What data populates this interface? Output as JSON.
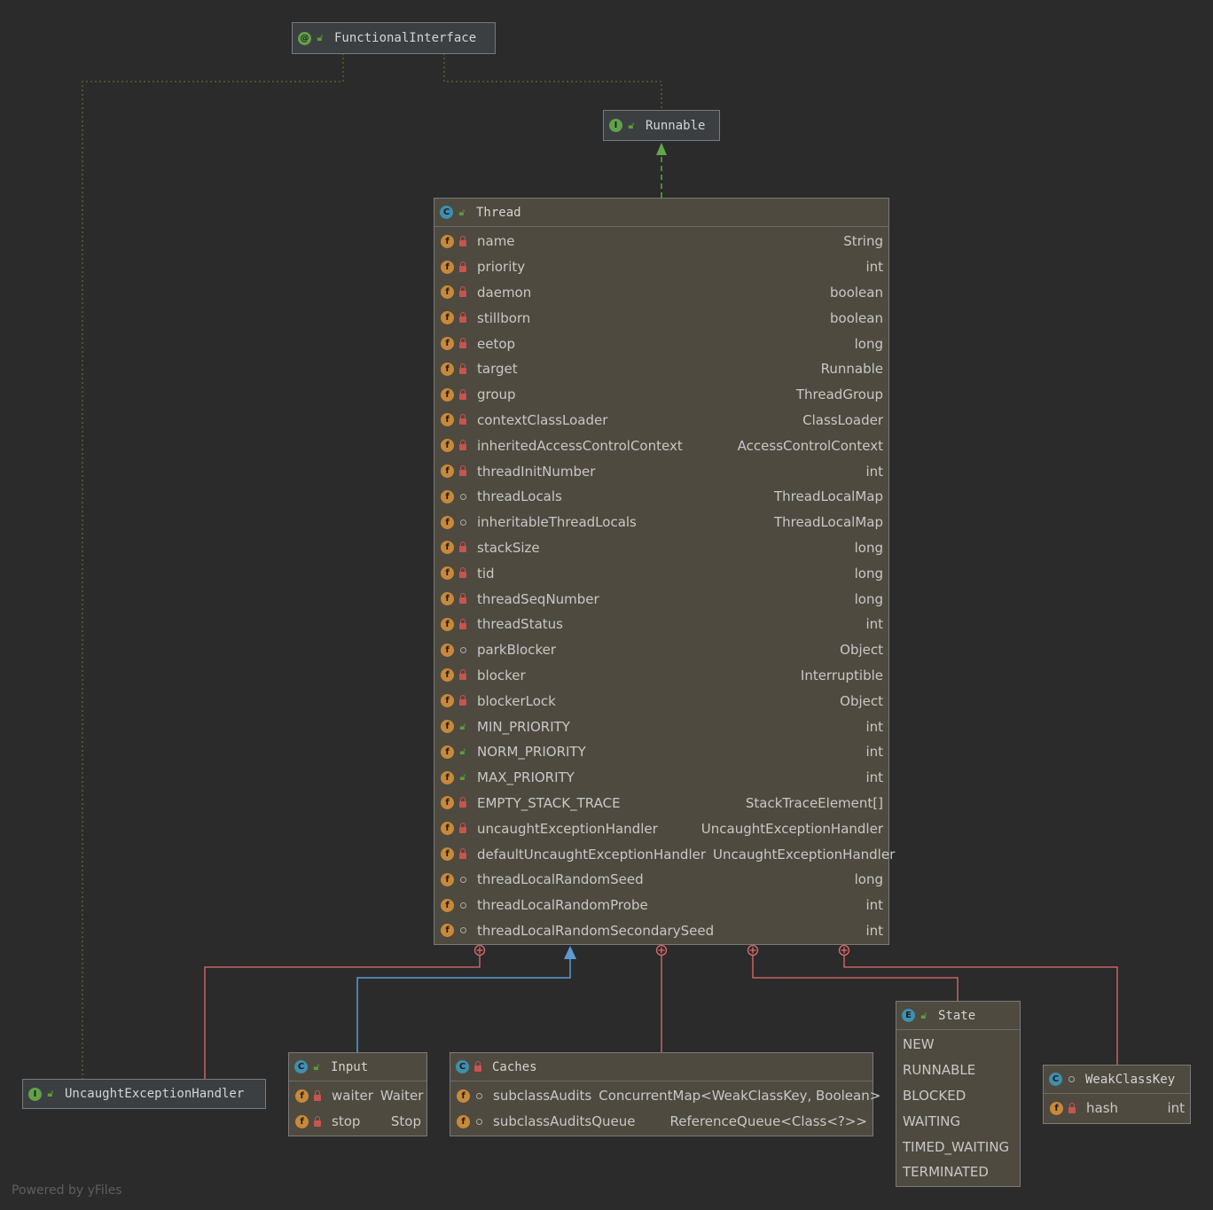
{
  "watermark": "Powered by yFiles",
  "colors": {
    "background": "#2b2b2b",
    "node_fill": "#4e4a3f",
    "inner_class_edge": "#e06c6c",
    "extends_edge": "#5b9bd5",
    "implements_edge": "#5fa84b",
    "annotation_edge": "#6a7a3a"
  },
  "nodes": {
    "functional_interface": {
      "name": "FunctionalInterface",
      "kind_icon": "annotation-icon",
      "badge": "@"
    },
    "runnable": {
      "name": "Runnable",
      "kind_icon": "interface-icon",
      "badge": "I"
    },
    "thread": {
      "name": "Thread",
      "kind_icon": "class-icon",
      "badge": "C",
      "fields": [
        {
          "name": "name",
          "type": "String",
          "vis": "private"
        },
        {
          "name": "priority",
          "type": "int",
          "vis": "private"
        },
        {
          "name": "daemon",
          "type": "boolean",
          "vis": "private"
        },
        {
          "name": "stillborn",
          "type": "boolean",
          "vis": "private"
        },
        {
          "name": "eetop",
          "type": "long",
          "vis": "private"
        },
        {
          "name": "target",
          "type": "Runnable",
          "vis": "private"
        },
        {
          "name": "group",
          "type": "ThreadGroup",
          "vis": "private"
        },
        {
          "name": "contextClassLoader",
          "type": "ClassLoader",
          "vis": "private"
        },
        {
          "name": "inheritedAccessControlContext",
          "type": "AccessControlContext",
          "vis": "private"
        },
        {
          "name": "threadInitNumber",
          "type": "int",
          "vis": "private"
        },
        {
          "name": "threadLocals",
          "type": "ThreadLocalMap",
          "vis": "package"
        },
        {
          "name": "inheritableThreadLocals",
          "type": "ThreadLocalMap",
          "vis": "package"
        },
        {
          "name": "stackSize",
          "type": "long",
          "vis": "private"
        },
        {
          "name": "tid",
          "type": "long",
          "vis": "private"
        },
        {
          "name": "threadSeqNumber",
          "type": "long",
          "vis": "private"
        },
        {
          "name": "threadStatus",
          "type": "int",
          "vis": "private"
        },
        {
          "name": "parkBlocker",
          "type": "Object",
          "vis": "package"
        },
        {
          "name": "blocker",
          "type": "Interruptible",
          "vis": "private"
        },
        {
          "name": "blockerLock",
          "type": "Object",
          "vis": "private"
        },
        {
          "name": "MIN_PRIORITY",
          "type": "int",
          "vis": "public"
        },
        {
          "name": "NORM_PRIORITY",
          "type": "int",
          "vis": "public"
        },
        {
          "name": "MAX_PRIORITY",
          "type": "int",
          "vis": "public"
        },
        {
          "name": "EMPTY_STACK_TRACE",
          "type": "StackTraceElement[]",
          "vis": "private"
        },
        {
          "name": "uncaughtExceptionHandler",
          "type": "UncaughtExceptionHandler",
          "vis": "private"
        },
        {
          "name": "defaultUncaughtExceptionHandler",
          "type": "UncaughtExceptionHandler",
          "vis": "private"
        },
        {
          "name": "threadLocalRandomSeed",
          "type": "long",
          "vis": "package"
        },
        {
          "name": "threadLocalRandomProbe",
          "type": "int",
          "vis": "package"
        },
        {
          "name": "threadLocalRandomSecondarySeed",
          "type": "int",
          "vis": "package"
        }
      ]
    },
    "uncaught_handler": {
      "name": "UncaughtExceptionHandler",
      "kind_icon": "interface-icon",
      "badge": "I"
    },
    "input": {
      "name": "Input",
      "kind_icon": "class-icon",
      "badge": "C",
      "fields": [
        {
          "name": "waiter",
          "type": "Waiter",
          "vis": "private"
        },
        {
          "name": "stop",
          "type": "Stop",
          "vis": "private"
        }
      ]
    },
    "caches": {
      "name": "Caches",
      "kind_icon": "class-icon",
      "badge": "C",
      "fields": [
        {
          "name": "subclassAudits",
          "type": "ConcurrentMap<WeakClassKey, Boolean>",
          "vis": "package"
        },
        {
          "name": "subclassAuditsQueue",
          "type": "ReferenceQueue<Class<?>>",
          "vis": "package"
        }
      ]
    },
    "state": {
      "name": "State",
      "kind_icon": "enum-icon",
      "badge": "E",
      "constants": [
        "NEW",
        "RUNNABLE",
        "BLOCKED",
        "WAITING",
        "TIMED_WAITING",
        "TERMINATED"
      ]
    },
    "weak_class_key": {
      "name": "WeakClassKey",
      "kind_icon": "class-icon",
      "badge": "C",
      "fields": [
        {
          "name": "hash",
          "type": "int",
          "vis": "private"
        }
      ]
    }
  }
}
